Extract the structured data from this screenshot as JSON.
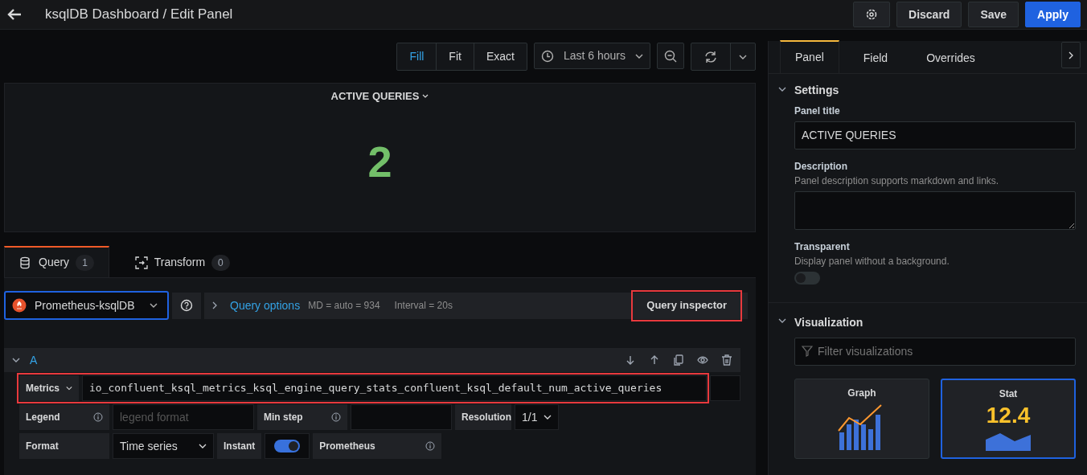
{
  "header": {
    "title": "ksqlDB Dashboard / Edit Panel",
    "buttons": [
      {
        "label": "Discard",
        "kind": "secondary"
      },
      {
        "label": "Save",
        "kind": "secondary"
      },
      {
        "label": "Apply",
        "kind": "primary"
      }
    ]
  },
  "toolbar": {
    "modes": [
      {
        "label": "Fill",
        "selected": true
      },
      {
        "label": "Fit",
        "selected": false
      },
      {
        "label": "Exact",
        "selected": false
      }
    ],
    "time_range": "Last 6 hours"
  },
  "panel": {
    "title": "ACTIVE QUERIES",
    "value": "2"
  },
  "query_tabs": [
    {
      "label": "Query",
      "count": "1",
      "kind": "query",
      "selected": true
    },
    {
      "label": "Transform",
      "count": "0",
      "kind": "transform",
      "selected": false
    }
  ],
  "datasource": {
    "name": "Prometheus-ksqlDB",
    "options_label": "Query options",
    "md": "MD = auto = 934",
    "interval": "Interval = 20s",
    "inspector": {
      "label": "Query inspector",
      "highlighted": true
    }
  },
  "query": {
    "letter": "A",
    "metrics": {
      "label": "Metrics",
      "value": "io_confluent_ksql_metrics_ksql_engine_query_stats_confluent_ksql_default_num_active_queries",
      "highlighted": true
    },
    "legend": {
      "label": "Legend",
      "placeholder": "legend format"
    },
    "min_step": {
      "label": "Min step"
    },
    "resolution": {
      "label": "Resolution",
      "value": "1/1"
    },
    "format": {
      "label": "Format",
      "value": "Time series"
    },
    "instant": {
      "label": "Instant",
      "on": true
    },
    "type_label": "Prometheus"
  },
  "options_tabs": [
    {
      "label": "Panel",
      "selected": true
    },
    {
      "label": "Field",
      "selected": false
    },
    {
      "label": "Overrides",
      "selected": false
    }
  ],
  "settings": {
    "title": "Settings",
    "expanded": true,
    "panel_title": {
      "label": "Panel title",
      "value": "ACTIVE QUERIES"
    },
    "description": {
      "label": "Description",
      "hint": "Panel description supports markdown and links."
    },
    "transparent": {
      "label": "Transparent",
      "hint": "Display panel without a background.",
      "on": false
    }
  },
  "visualization": {
    "title": "Visualization",
    "expanded": true,
    "filter_placeholder": "Filter visualizations",
    "items": [
      {
        "name": "Graph",
        "kind": "graph",
        "selected": false
      },
      {
        "name": "Stat",
        "kind": "stat",
        "preview": "12.4",
        "selected": true
      }
    ]
  }
}
